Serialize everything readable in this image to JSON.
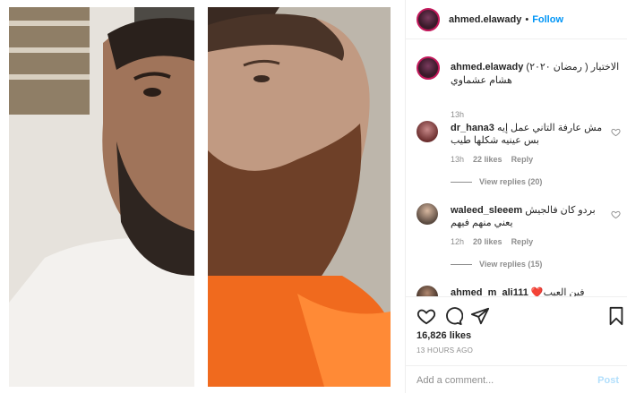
{
  "header": {
    "username": "ahmed.elawady",
    "separator": "•",
    "follow_label": "Follow"
  },
  "caption": {
    "username": "ahmed.elawady",
    "text": "الاختيار ( رمضان ٢٠٢٠) هشام عشماوي",
    "time": "13h"
  },
  "comments": [
    {
      "username": "dr_hana3",
      "text": "مش عارفة التاني عمل إيه بس عينيه شكلها طيب",
      "time": "13h",
      "likes": "22 likes",
      "reply_label": "Reply",
      "view_replies": "View replies (20)"
    },
    {
      "username": "waleed_sleeem",
      "text": "بردو كان فالجيش يعني منهم فيهم",
      "time": "12h",
      "likes": "20 likes",
      "reply_label": "Reply",
      "view_replies": "View replies (15)"
    },
    {
      "username": "ahmed_m_ali111",
      "text": "❤️فين العيب"
    }
  ],
  "actions": {
    "likes": "16,826 likes",
    "time_ago": "13 HOURS AGO",
    "add_comment_placeholder": "Add a comment...",
    "post_label": "Post"
  },
  "colors": {
    "link_blue": "#0095f6",
    "post_disabled": "#b2dffc",
    "muted": "#8e8e8e",
    "divider": "#efefef"
  }
}
